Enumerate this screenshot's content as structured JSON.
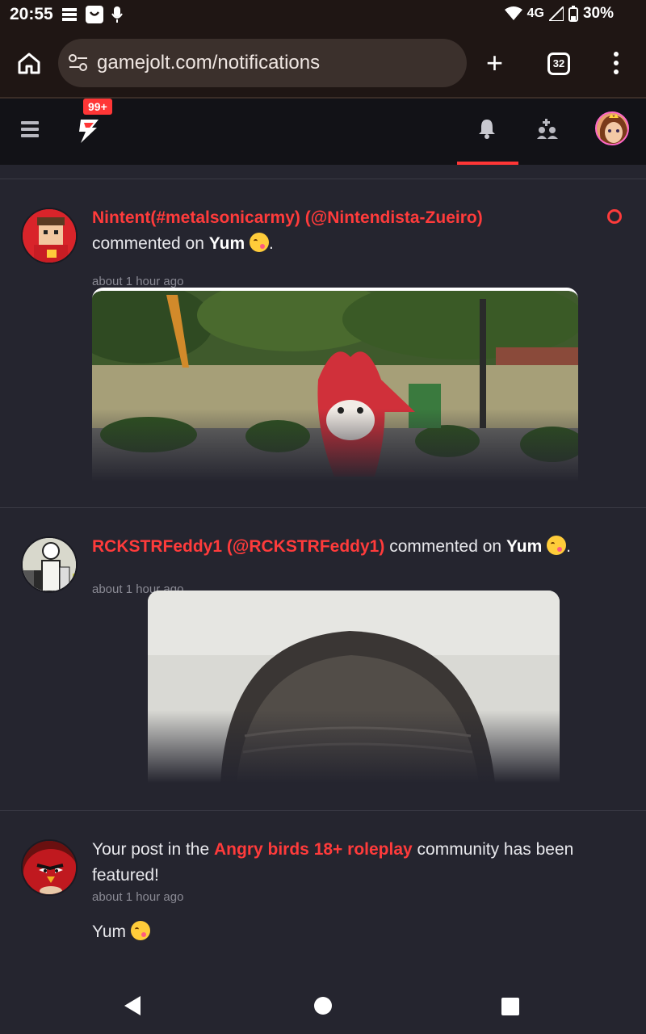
{
  "status_bar": {
    "time": "20:55",
    "network": "4G",
    "battery": "30%"
  },
  "browser": {
    "url": "gamejolt.com/notifications",
    "tab_count": "32"
  },
  "gj_nav": {
    "notification_badge": "99+"
  },
  "notifications": [
    {
      "user": "Nintent(#metalsonicarmy) (@Nintendista-Zueiro)",
      "action": "commented on",
      "target": "Yum",
      "time": "about 1 hour ago",
      "unread": true
    },
    {
      "user": "RCKSTRFeddy1 (@RCKSTRFeddy1)",
      "action": "commented on",
      "target": "Yum",
      "time": "about 1 hour ago"
    },
    {
      "prefix": "Your post in the",
      "community": "Angry birds 18+ roleplay",
      "suffix": "community has been featured!",
      "time": "about 1 hour ago",
      "post_text": "Yum"
    }
  ]
}
